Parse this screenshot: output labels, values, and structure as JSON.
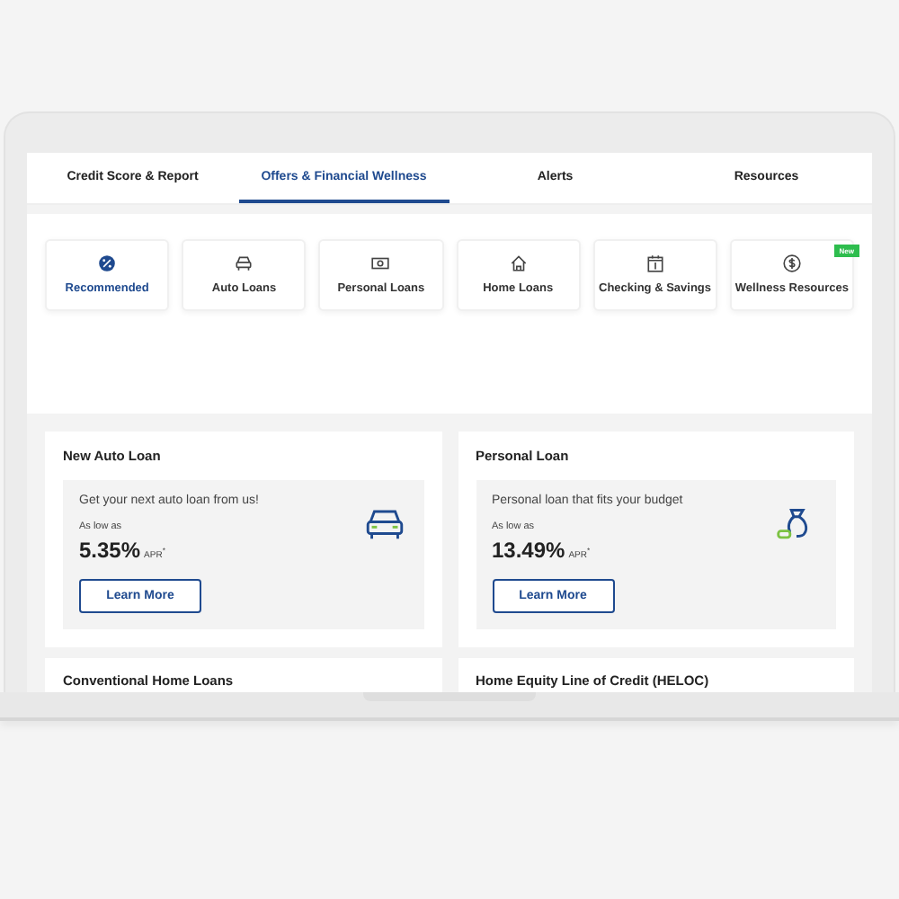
{
  "tabs": [
    {
      "label": "Credit Score & Report",
      "selected": false
    },
    {
      "label": "Offers & Financial Wellness",
      "selected": true
    },
    {
      "label": "Alerts",
      "selected": false
    },
    {
      "label": "Resources",
      "selected": false
    }
  ],
  "categories": [
    {
      "label": "Recommended",
      "kind": "percent",
      "selected": true
    },
    {
      "label": "Auto Loans",
      "kind": "car",
      "selected": false
    },
    {
      "label": "Personal Loans",
      "kind": "cash",
      "selected": false
    },
    {
      "label": "Home Loans",
      "kind": "house",
      "selected": false
    },
    {
      "label": "Checking & Savings",
      "kind": "calendar",
      "selected": false
    },
    {
      "label": "Wellness Resources",
      "kind": "dollar",
      "selected": false,
      "badge": "New"
    }
  ],
  "offers": [
    {
      "title": "New Auto Loan",
      "kind": "car",
      "tagline": "Get your next auto loan from us!",
      "rate_label": "As low as",
      "rate": "5.35%",
      "rate_unit": "APR$^{*}$",
      "button": "Learn More"
    },
    {
      "title": "Personal Loan",
      "kind": "bag",
      "tagline": "Personal loan that fits your budget",
      "rate_label": "As low as",
      "rate": "13.49%",
      "rate_unit": "APR$^{*}$",
      "button": "Learn More"
    },
    {
      "title": "Conventional Home Loans"
    },
    {
      "title": "Home Equity Line of Credit (HELOC)"
    }
  ]
}
